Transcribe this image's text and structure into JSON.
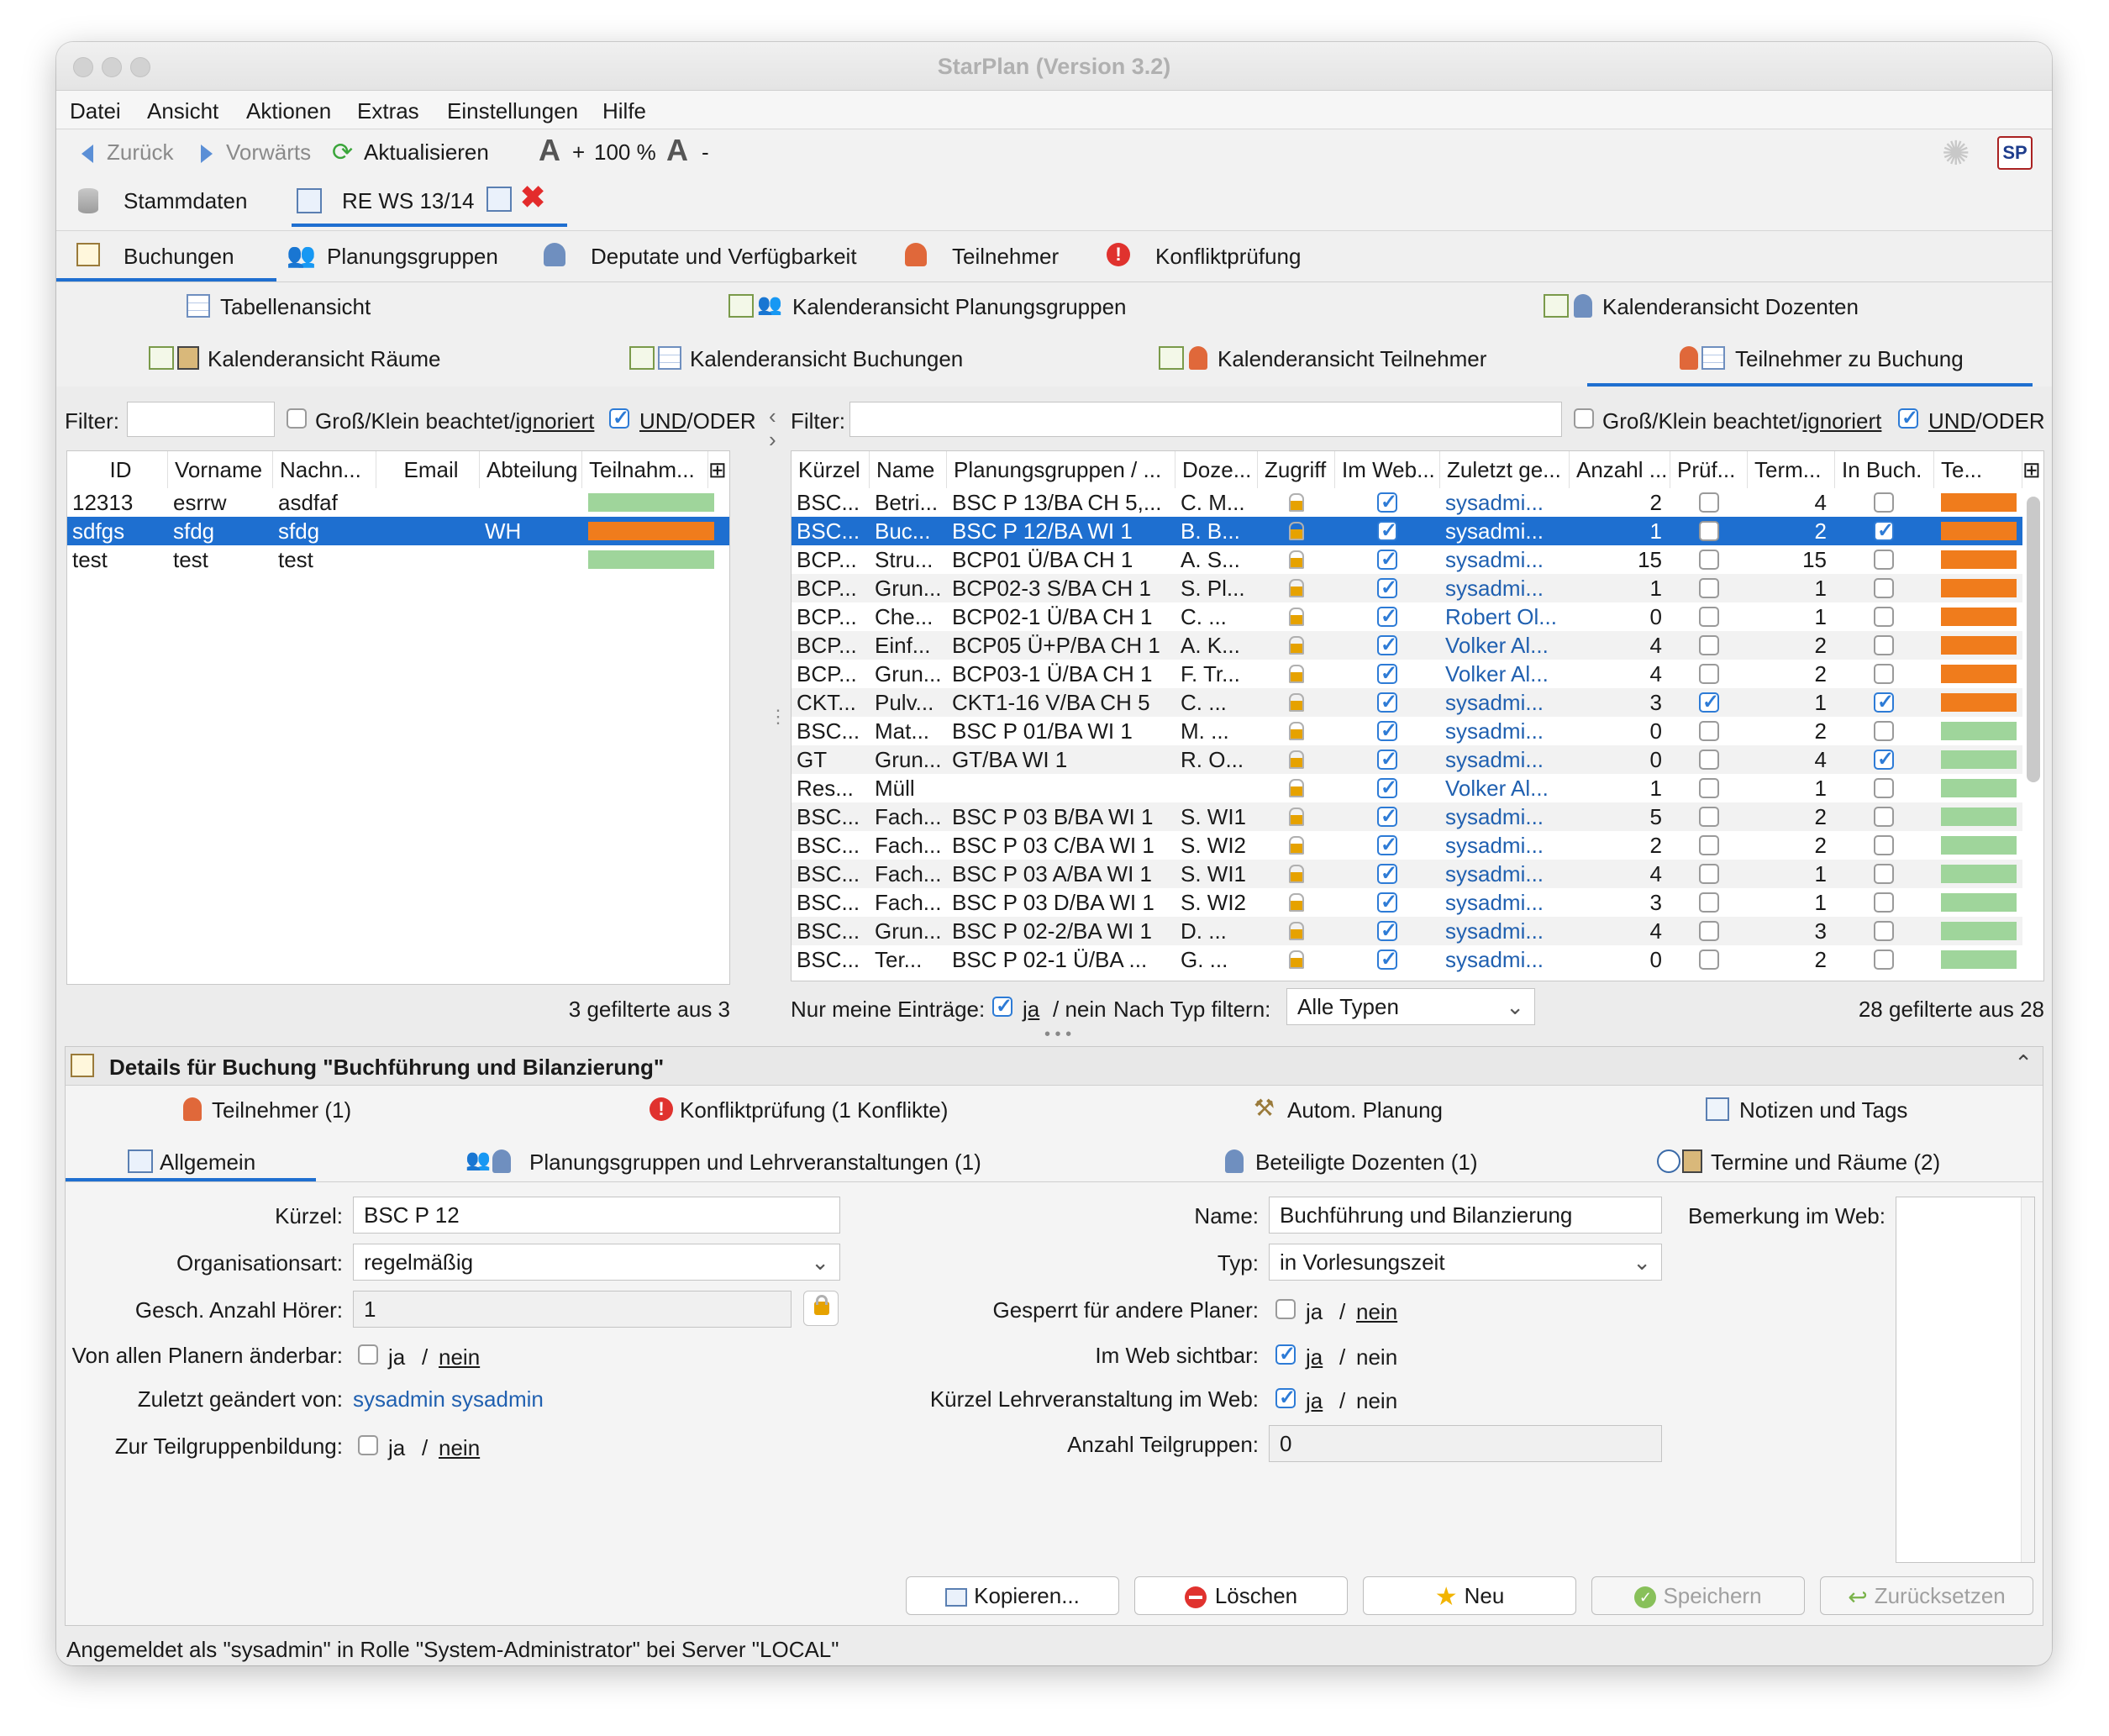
{
  "window": {
    "title": "StarPlan (Version 3.2)"
  },
  "menu": [
    "Datei",
    "Ansicht",
    "Aktionen",
    "Extras",
    "Einstellungen",
    "Hilfe"
  ],
  "toolbar": {
    "back": "Zurück",
    "forward": "Vorwärts",
    "refresh": "Aktualisieren",
    "zoom": "100 %",
    "zoom_plus": "+",
    "zoom_minus": "-",
    "logo": "SP"
  },
  "doc_tabs": [
    "Stammdaten",
    "RE WS 13/14"
  ],
  "main_tabs": [
    "Buchungen",
    "Planungsgruppen",
    "Deputate und Verfügbarkeit",
    "Teilnehmer",
    "Konfliktprüfung"
  ],
  "views": [
    "Tabellenansicht",
    "Kalenderansicht Planungsgruppen",
    "Kalenderansicht Dozenten",
    "Kalenderansicht Räume",
    "Kalenderansicht Buchungen",
    "Kalenderansicht Teilnehmer",
    "Teilnehmer zu Buchung"
  ],
  "filter": {
    "label": "Filter:",
    "case": "Groß/Klein beachtet/",
    "case_u": "ignoriert",
    "andor_u": "UND",
    "andor": "/ODER"
  },
  "left_table": {
    "headers": [
      "ID",
      "Vorname",
      "Nachn...",
      "Email",
      "Abteilung",
      "Teilnahm..."
    ],
    "rows": [
      {
        "id": "12313",
        "vorname": "esrrw",
        "nachname": "asdfaf",
        "email": "",
        "abteilung": "",
        "bar": "#9fd59b"
      },
      {
        "id": "sdfgs",
        "vorname": "sfdg",
        "nachname": "sfdg",
        "email": "",
        "abteilung": "WH",
        "bar": "#f07c1c"
      },
      {
        "id": "test",
        "vorname": "test",
        "nachname": "test",
        "email": "",
        "abteilung": "",
        "bar": "#9fd59b"
      }
    ],
    "count": "3 gefilterte aus 3"
  },
  "right_table": {
    "headers": [
      "Kürzel",
      "Name",
      "Planungsgruppen / ...",
      "Doze...",
      "Zugriff",
      "Im Web...",
      "Zuletzt ge...",
      "Anzahl ...",
      "Prüf...",
      "Term...",
      "In Buch.",
      "Te..."
    ],
    "rows": [
      {
        "k": "BSC...",
        "n": "Betri...",
        "p": "BSC P 13/BA CH 5,...",
        "d": "C. M...",
        "web": true,
        "z": "sysadmi...",
        "a": "2",
        "pr": false,
        "t": "4",
        "ib": false,
        "bar": "#f07c1c"
      },
      {
        "k": "BSC...",
        "n": "Buc...",
        "p": "BSC P 12/BA WI 1",
        "d": "B. B...",
        "web": true,
        "z": "sysadmi...",
        "a": "1",
        "pr": false,
        "t": "2",
        "ib": true,
        "bar": "#f07c1c"
      },
      {
        "k": "BCP...",
        "n": "Stru...",
        "p": "BCP01 Ü/BA CH 1",
        "d": "A. S...",
        "web": true,
        "z": "sysadmi...",
        "a": "15",
        "pr": false,
        "t": "15",
        "ib": false,
        "bar": "#f07c1c"
      },
      {
        "k": "BCP...",
        "n": "Grun...",
        "p": "BCP02-3 S/BA CH 1",
        "d": "S. Pl...",
        "web": true,
        "z": "sysadmi...",
        "a": "1",
        "pr": false,
        "t": "1",
        "ib": false,
        "bar": "#f07c1c"
      },
      {
        "k": "BCP...",
        "n": "Che...",
        "p": "BCP02-1 Ü/BA CH 1",
        "d": "C. ...",
        "web": true,
        "z": "Robert Ol...",
        "a": "0",
        "pr": false,
        "t": "1",
        "ib": false,
        "bar": "#f07c1c"
      },
      {
        "k": "BCP...",
        "n": "Einf...",
        "p": "BCP05 Ü+P/BA CH 1",
        "d": "A. K...",
        "web": true,
        "z": "Volker Al...",
        "a": "4",
        "pr": false,
        "t": "2",
        "ib": false,
        "bar": "#f07c1c"
      },
      {
        "k": "BCP...",
        "n": "Grun...",
        "p": "BCP03-1 Ü/BA CH 1",
        "d": "F. Tr...",
        "web": true,
        "z": "Volker Al...",
        "a": "4",
        "pr": false,
        "t": "2",
        "ib": false,
        "bar": "#f07c1c"
      },
      {
        "k": "CKT...",
        "n": "Pulv...",
        "p": "CKT1-16 V/BA CH 5",
        "d": "C. ...",
        "web": true,
        "z": "sysadmi...",
        "a": "3",
        "pr": true,
        "t": "1",
        "ib": true,
        "bar": "#f07c1c"
      },
      {
        "k": "BSC...",
        "n": "Mat...",
        "p": "BSC P 01/BA WI 1",
        "d": "M. ...",
        "web": true,
        "z": "sysadmi...",
        "a": "0",
        "pr": false,
        "t": "2",
        "ib": false,
        "bar": "#9fd59b"
      },
      {
        "k": "GT",
        "n": "Grun...",
        "p": "GT/BA WI 1",
        "d": "R. O...",
        "web": true,
        "z": "sysadmi...",
        "a": "0",
        "pr": false,
        "t": "4",
        "ib": true,
        "bar": "#9fd59b"
      },
      {
        "k": "Res...",
        "n": "Müll",
        "p": "",
        "d": "",
        "web": true,
        "z": "Volker Al...",
        "a": "1",
        "pr": false,
        "t": "1",
        "ib": false,
        "bar": "#9fd59b"
      },
      {
        "k": "BSC...",
        "n": "Fach...",
        "p": "BSC P 03 B/BA WI 1",
        "d": "S. WI1",
        "web": true,
        "z": "sysadmi...",
        "a": "5",
        "pr": false,
        "t": "2",
        "ib": false,
        "bar": "#9fd59b"
      },
      {
        "k": "BSC...",
        "n": "Fach...",
        "p": "BSC P 03 C/BA WI 1",
        "d": "S. WI2",
        "web": true,
        "z": "sysadmi...",
        "a": "2",
        "pr": false,
        "t": "2",
        "ib": false,
        "bar": "#9fd59b"
      },
      {
        "k": "BSC...",
        "n": "Fach...",
        "p": "BSC P 03 A/BA WI 1",
        "d": "S. WI1",
        "web": true,
        "z": "sysadmi...",
        "a": "4",
        "pr": false,
        "t": "1",
        "ib": false,
        "bar": "#9fd59b"
      },
      {
        "k": "BSC...",
        "n": "Fach...",
        "p": "BSC P 03 D/BA WI 1",
        "d": "S. WI2",
        "web": true,
        "z": "sysadmi...",
        "a": "3",
        "pr": false,
        "t": "1",
        "ib": false,
        "bar": "#9fd59b"
      },
      {
        "k": "BSC...",
        "n": "Grun...",
        "p": "BSC P 02-2/BA WI 1",
        "d": "D. ...",
        "web": true,
        "z": "sysadmi...",
        "a": "4",
        "pr": false,
        "t": "3",
        "ib": false,
        "bar": "#9fd59b"
      },
      {
        "k": "BSC...",
        "n": "Ter...",
        "p": "BSC P 02-1 Ü/BA ...",
        "d": "G. ...",
        "web": true,
        "z": "sysadmi...",
        "a": "0",
        "pr": false,
        "t": "2",
        "ib": false,
        "bar": "#9fd59b"
      }
    ],
    "only_mine": "Nur meine Einträge:",
    "ja": "ja",
    "nein": "/ nein",
    "type_filter": "Nach Typ filtern:",
    "type_value": "Alle Typen",
    "count": "28 gefilterte aus 28"
  },
  "details": {
    "title": "Details für Buchung \"Buchführung und Bilanzierung\"",
    "tabs_row1": [
      "Teilnehmer (1)",
      "Konfliktprüfung (1 Konflikte)",
      "Autom. Planung",
      "Notizen und Tags"
    ],
    "tabs_row2": [
      "Allgemein",
      "Planungsgruppen und Lehrveranstaltungen (1)",
      "Beteiligte Dozenten (1)",
      "Termine und Räume (2)"
    ],
    "left": {
      "kuerzel_l": "Kürzel:",
      "kuerzel": "BSC P 12",
      "orga_l": "Organisationsart:",
      "orga": "regelmäßig",
      "hoerer_l": "Gesch. Anzahl Hörer:",
      "hoerer": "1",
      "aenderbar_l": "Von allen Planern änderbar:",
      "zuletzt_l": "Zuletzt geändert von:",
      "zuletzt": "sysadmin sysadmin",
      "teilgruppe_l": "Zur Teilgruppenbildung:"
    },
    "right": {
      "name_l": "Name:",
      "name": "Buchführung und Bilanzierung",
      "typ_l": "Typ:",
      "typ": "in Vorlesungszeit",
      "gesperrt_l": "Gesperrt für andere Planer:",
      "web_l": "Im Web sichtbar:",
      "kuerzel_web_l": "Kürzel Lehrveranstaltung im Web:",
      "anzahl_l": "Anzahl Teilgruppen:",
      "anzahl": "0"
    },
    "bemerkung_l": "Bemerkung im Web:",
    "ja": "ja",
    "slash": "/",
    "nein": "nein",
    "buttons": [
      "Kopieren...",
      "Löschen",
      "Neu",
      "Speichern",
      "Zurücksetzen"
    ]
  },
  "status": "Angemeldet als \"sysadmin\" in Rolle \"System-Administrator\" bei Server \"LOCAL\""
}
